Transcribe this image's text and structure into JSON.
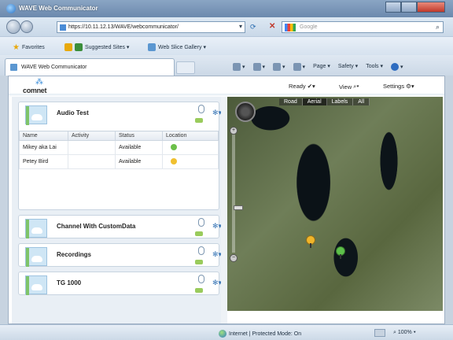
{
  "window": {
    "title": "WAVE Web Communicator"
  },
  "address_bar": {
    "url": "https://10.11.12.13/WAVE/webcommunicator/"
  },
  "search": {
    "placeholder": "Google"
  },
  "favorites_bar": {
    "favorites": "Favorites",
    "suggested": "Suggested Sites ▾",
    "gallery": "Web Slice Gallery ▾"
  },
  "tab": {
    "label": "WAVE Web Communicator"
  },
  "command_bar": {
    "page": "Page ▾",
    "safety": "Safety ▾",
    "tools": "Tools ▾",
    "help": "▾"
  },
  "app": {
    "logo": "comnet",
    "ready": "Ready",
    "view": "View",
    "settings": "Settings"
  },
  "channels": [
    {
      "title": "Audio Test"
    },
    {
      "title": "Channel With CustomData"
    },
    {
      "title": "Recordings"
    },
    {
      "title": "TG 1000"
    }
  ],
  "users_table": {
    "columns": [
      "Name",
      "Activity",
      "Status",
      "Location"
    ],
    "rows": [
      {
        "name": "Mikey aka Lai",
        "activity": "",
        "status": "Available",
        "pin_color": "#6cc04a"
      },
      {
        "name": "Petey Bird",
        "activity": "",
        "status": "Available",
        "pin_color": "#f0c030"
      }
    ]
  },
  "map": {
    "tabs": [
      "Road",
      "Aerial",
      "Labels",
      "All"
    ],
    "selected_tab": "Aerial",
    "pins": [
      {
        "color": "#f0b52a"
      },
      {
        "color": "#5dc04a"
      }
    ]
  },
  "status_bar": {
    "zone": "Internet | Protected Mode: On",
    "zoom": "100%"
  },
  "colors": {
    "titlebar": "#7a96b9",
    "accent": "#3f8fd9"
  }
}
